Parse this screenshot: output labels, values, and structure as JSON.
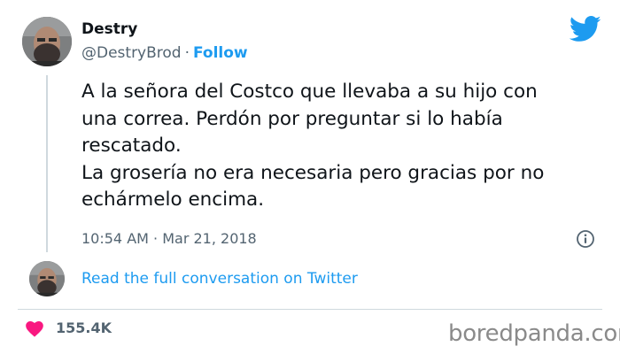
{
  "author": {
    "display_name": "Destry",
    "handle": "@DestryBrod",
    "separator": "·",
    "follow_label": "Follow"
  },
  "tweet": {
    "lines": [
      "A la señora del Costco que llevaba a su hijo con",
      "una correa. Perdón por preguntar si lo había",
      "rescatado.",
      "La grosería no era necesaria pero gracias por no",
      "echármelo encima."
    ],
    "timestamp": "10:54 AM · Mar 21, 2018"
  },
  "conversation_link": "Read the full conversation on Twitter",
  "likes": "155.4K",
  "watermark": "boredpanda.com",
  "icons": {
    "logo": "twitter-bird-icon",
    "info": "info-icon",
    "like": "heart-icon"
  },
  "colors": {
    "accent": "#1d9bf0",
    "heart": "#f91880",
    "muted": "#536471",
    "text": "#0f1419"
  }
}
